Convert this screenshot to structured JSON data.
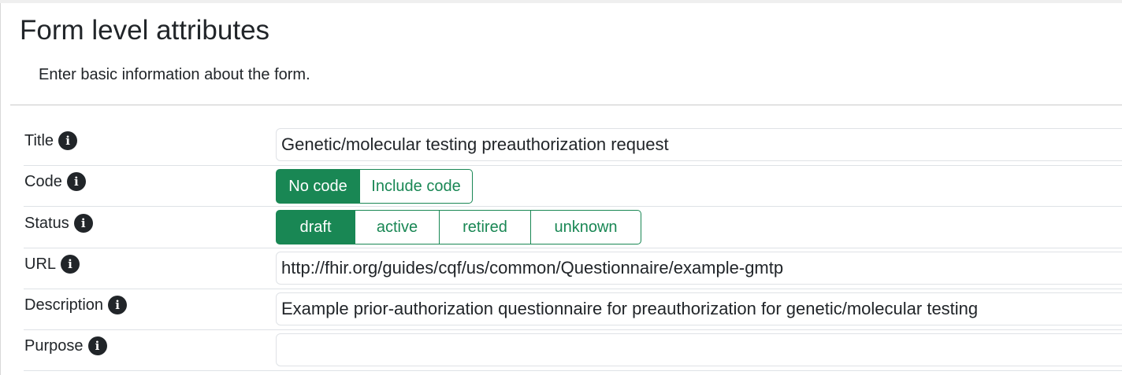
{
  "header": {
    "title": "Form level attributes",
    "subtitle": "Enter basic information about the form."
  },
  "fields": {
    "title": {
      "label": "Title",
      "value": "Genetic/molecular testing preauthorization request"
    },
    "code": {
      "label": "Code",
      "options": [
        "No code",
        "Include code"
      ],
      "selected": "No code"
    },
    "status": {
      "label": "Status",
      "options": [
        "draft",
        "active",
        "retired",
        "unknown"
      ],
      "selected": "draft"
    },
    "url": {
      "label": "URL",
      "value": "http://fhir.org/guides/cqf/us/common/Questionnaire/example-gmtp"
    },
    "description": {
      "label": "Description",
      "value": "Example prior-authorization questionnaire for preauthorization for genetic/molecular testing"
    },
    "purpose": {
      "label": "Purpose",
      "value": ""
    }
  },
  "icons": {
    "info": "info-circle-icon",
    "info_glyph": "i"
  },
  "colors": {
    "accent": "#198754",
    "text": "#212529",
    "border": "#dee2e6"
  }
}
